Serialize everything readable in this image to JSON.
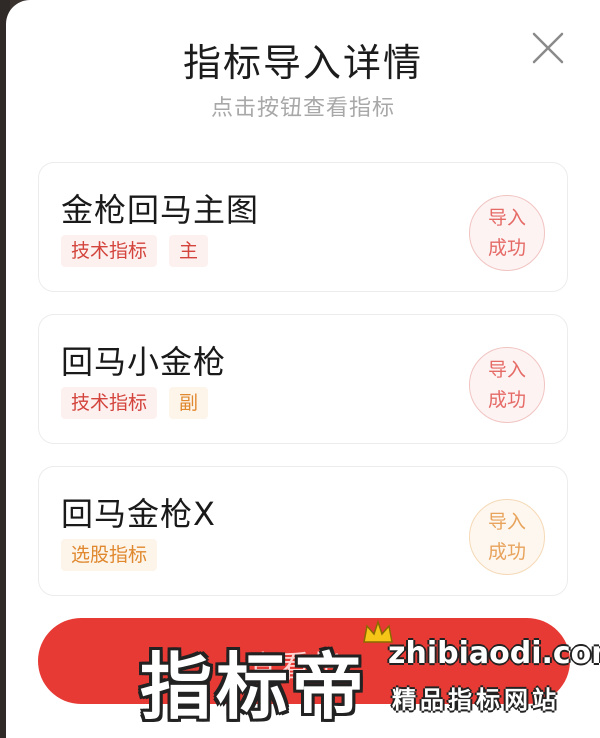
{
  "dialog": {
    "title": "指标导入详情",
    "subtitle": "点击按钮查看指标"
  },
  "indicators": [
    {
      "name": "金枪回马主图",
      "tags": [
        "技术指标",
        "主"
      ],
      "status": [
        "导入",
        "成功"
      ]
    },
    {
      "name": "回马小金枪",
      "tags": [
        "技术指标",
        "副"
      ],
      "status": [
        "导入",
        "成功"
      ]
    },
    {
      "name": "回马金枪X",
      "tags": [
        "选股指标"
      ],
      "status": [
        "导入",
        "成功"
      ]
    }
  ],
  "bottom_button": {
    "label": "查看指"
  },
  "watermark": {
    "brand": "指标帝",
    "url": "zhibiaodi.com",
    "tagline": "精品指标网站"
  },
  "colors": {
    "primary_red": "#e83a34",
    "tag_red": "#d3443c",
    "tag_orange": "#e0882e",
    "stamp_red": "#e56a66",
    "stamp_orange": "#e8a35c"
  },
  "icons": {
    "close": "close-icon",
    "crown": "crown-icon"
  }
}
